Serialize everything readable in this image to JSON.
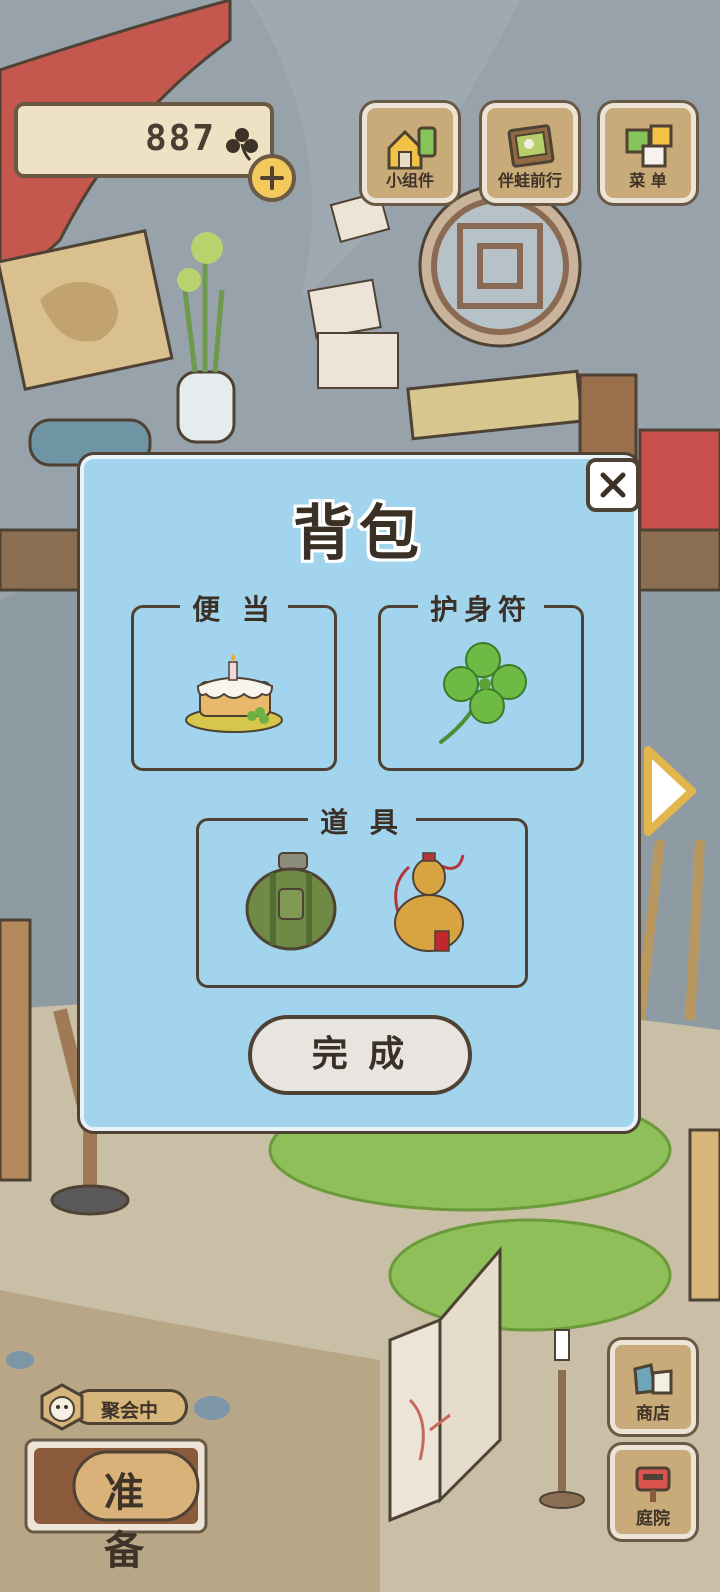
{
  "hud": {
    "clover_count": "887",
    "top_buttons": [
      {
        "label": "小组件",
        "icon": "widget-house-icon"
      },
      {
        "label": "伴蛙前行",
        "icon": "photo-album-icon"
      },
      {
        "label": "菜 单",
        "icon": "menu-squares-icon"
      }
    ],
    "party_status": "聚会中",
    "prepare_label": "准 备",
    "shop_label": "商店",
    "yard_label": "庭院"
  },
  "backpack": {
    "title": "背包",
    "lunch_label": "便 当",
    "charm_label": "护身符",
    "tools_label": "道 具",
    "items": {
      "lunch": "cake-icon",
      "charm": "four-leaf-clover-icon",
      "tool_1": "canteen-icon",
      "tool_2": "gourd-icon"
    },
    "done_label": "完 成"
  },
  "colors": {
    "modal_bg": "#a3d4ee",
    "wood": "#c9aa79",
    "outline": "#4e4234",
    "scene_grey": "#8e9aa1"
  }
}
